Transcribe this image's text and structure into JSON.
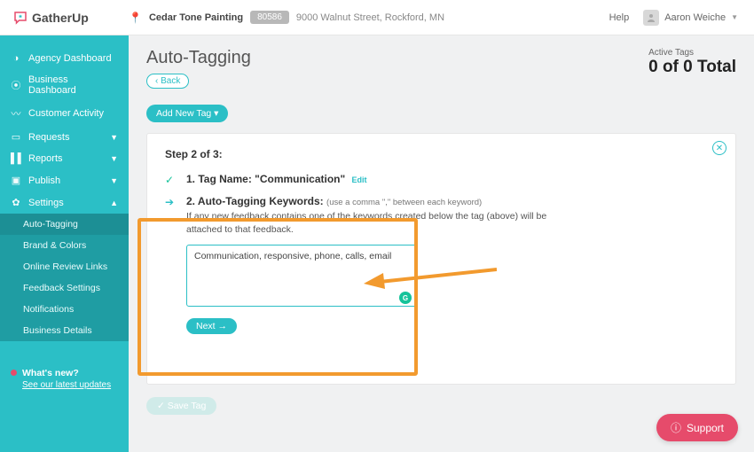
{
  "brand": "GatherUp",
  "location": {
    "name": "Cedar Tone Painting",
    "zip": "80586",
    "address": "9000 Walnut Street, Rockford, MN"
  },
  "topbar": {
    "help": "Help",
    "user": "Aaron Weiche"
  },
  "sidebar": {
    "items": [
      {
        "icon": "dashboard",
        "label": "Agency Dashboard"
      },
      {
        "icon": "pin",
        "label": "Business Dashboard"
      },
      {
        "icon": "activity",
        "label": "Customer Activity"
      },
      {
        "icon": "chat",
        "label": "Requests",
        "chevron": true
      },
      {
        "icon": "bars",
        "label": "Reports",
        "chevron": true
      },
      {
        "icon": "publish",
        "label": "Publish",
        "chevron": true
      },
      {
        "icon": "gear",
        "label": "Settings",
        "chevron": true,
        "expanded": true
      }
    ],
    "subitems": [
      "Auto-Tagging",
      "Brand & Colors",
      "Online Review Links",
      "Feedback Settings",
      "Notifications",
      "Business Details"
    ],
    "whatsnew": {
      "title": "What's new?",
      "link": "See our latest updates"
    }
  },
  "page": {
    "title": "Auto-Tagging",
    "back": "‹ Back",
    "add": "Add New Tag ▾",
    "active_tags_label": "Active Tags",
    "active_tags_value": "0 of 0 Total",
    "save": "✓ Save Tag"
  },
  "panel": {
    "step_header": "Step 2 of 3:",
    "step1": {
      "num": "1.",
      "label": "Tag Name: \"Communication\"",
      "edit": "Edit"
    },
    "step2": {
      "num": "2.",
      "label": "Auto-Tagging Keywords:",
      "hint": "(use a comma \",\" between each keyword)",
      "desc": "If any new feedback contains one of the keywords created below the tag (above) will be attached to that feedback.",
      "keywords": "Communication, responsive, phone, calls, email",
      "next": "Next →"
    }
  },
  "support": "Support"
}
